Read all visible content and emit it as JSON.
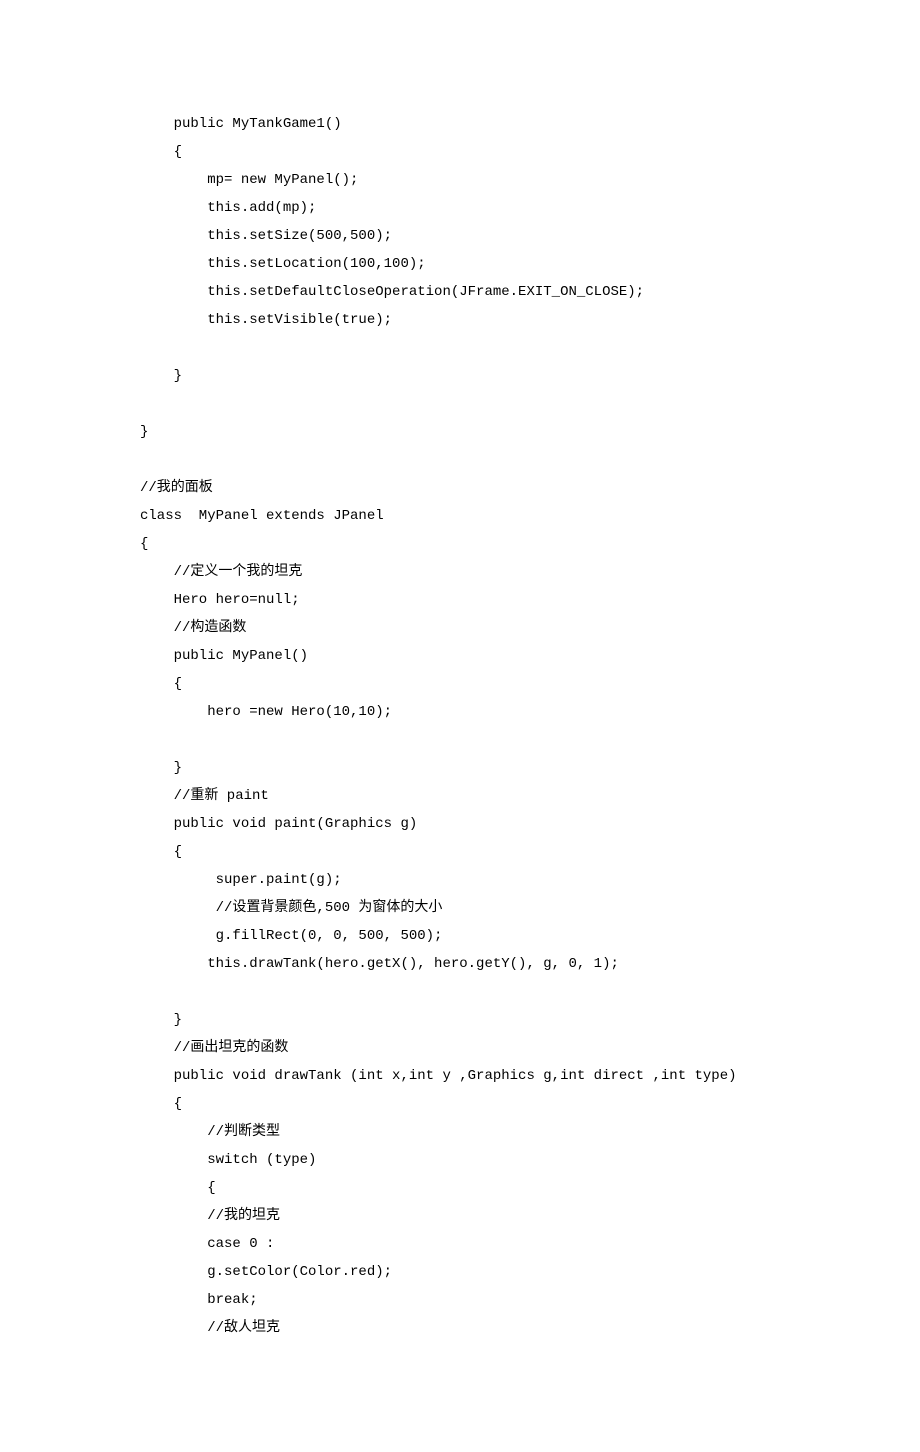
{
  "lines": [
    "    public MyTankGame1()",
    "    {",
    "        mp= new MyPanel();",
    "        this.add(mp);",
    "        this.setSize(500,500);",
    "        this.setLocation(100,100);",
    "        this.setDefaultCloseOperation(JFrame.EXIT_ON_CLOSE);",
    "        this.setVisible(true);",
    "",
    "    }",
    "",
    "}",
    "",
    "//我的面板",
    "class  MyPanel extends JPanel",
    "{",
    "    //定义一个我的坦克",
    "    Hero hero=null;",
    "    //构造函数",
    "    public MyPanel()",
    "    {",
    "        hero =new Hero(10,10);",
    "",
    "    }",
    "    //重新 paint",
    "    public void paint(Graphics g)",
    "    {",
    "         super.paint(g);",
    "         //设置背景颜色,500 为窗体的大小",
    "         g.fillRect(0, 0, 500, 500);",
    "        this.drawTank(hero.getX(), hero.getY(), g, 0, 1);",
    "",
    "    }",
    "    //画出坦克的函数",
    "    public void drawTank (int x,int y ,Graphics g,int direct ,int type)",
    "    {",
    "        //判断类型",
    "        switch (type)",
    "        {",
    "        //我的坦克",
    "        case 0 :",
    "        g.setColor(Color.red);",
    "        break;",
    "        //敌人坦克"
  ]
}
